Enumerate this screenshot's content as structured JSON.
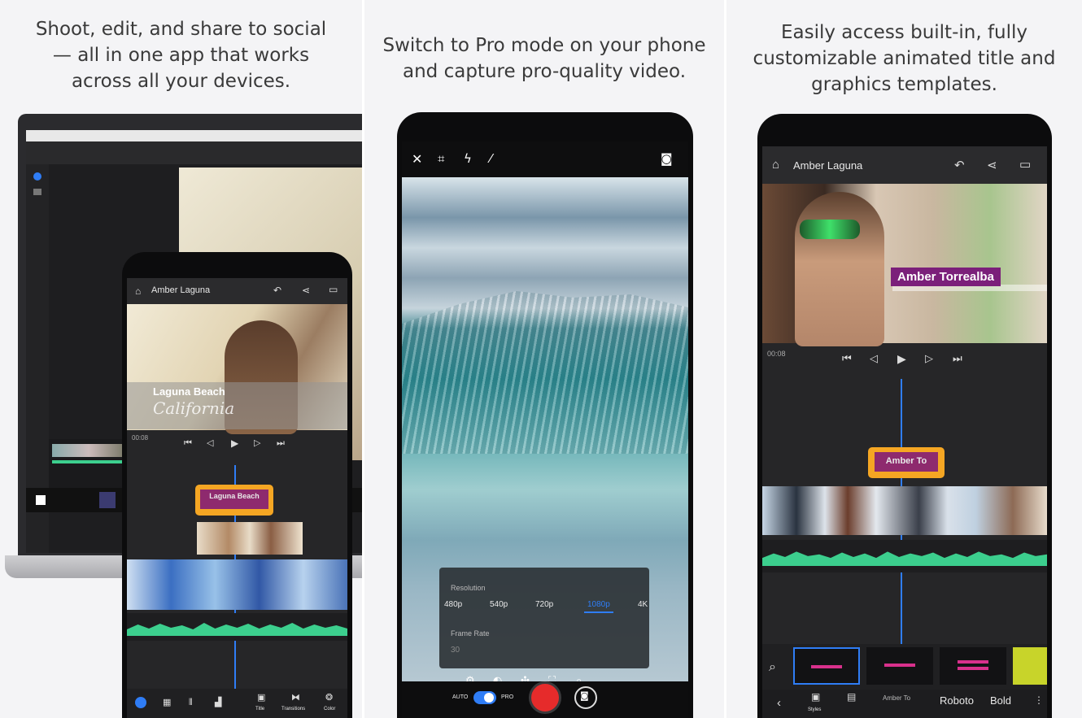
{
  "headlines": {
    "left": [
      "Shoot, edit, and share to social",
      "— all in one app that works",
      "across all your devices."
    ],
    "middle": [
      "Switch to Pro mode on your phone",
      "and capture pro-quality video."
    ],
    "right": [
      "Easily access built-in, fully",
      "customizable animated title and",
      "graphics templates."
    ]
  },
  "left_phone": {
    "project_title": "Amber Laguna",
    "overlay_title": "Laguna Beach",
    "overlay_subtitle": "California",
    "timecode": "00:08",
    "title_clip_label": "Laguna Beach",
    "bottom_labels": {
      "item1": "Title",
      "item2": "Transitions",
      "item3": "Color"
    }
  },
  "middle_phone": {
    "resolution_label": "Resolution",
    "resolutions": [
      "480p",
      "540p",
      "720p",
      "1080p",
      "4K"
    ],
    "selected_resolution": "1080p",
    "frame_rate_label": "Frame Rate",
    "frame_rate_value": "30",
    "mode_auto": "AUTO",
    "mode_pro": "PRO"
  },
  "right_phone": {
    "project_title": "Amber Laguna",
    "lower_third": "Amber Torrealba",
    "timecode": "00:08",
    "title_clip_label": "Amber To",
    "font_name": "Roboto",
    "font_weight": "Bold",
    "bottom_labels": {
      "styles": "Styles",
      "layer": "Amber To"
    }
  },
  "colors": {
    "accent_blue": "#2f7df6",
    "title_purple": "#7b1f7a",
    "title_orange": "#f5a623",
    "audio_green": "#3ccf8e",
    "record_red": "#e62b2b"
  }
}
